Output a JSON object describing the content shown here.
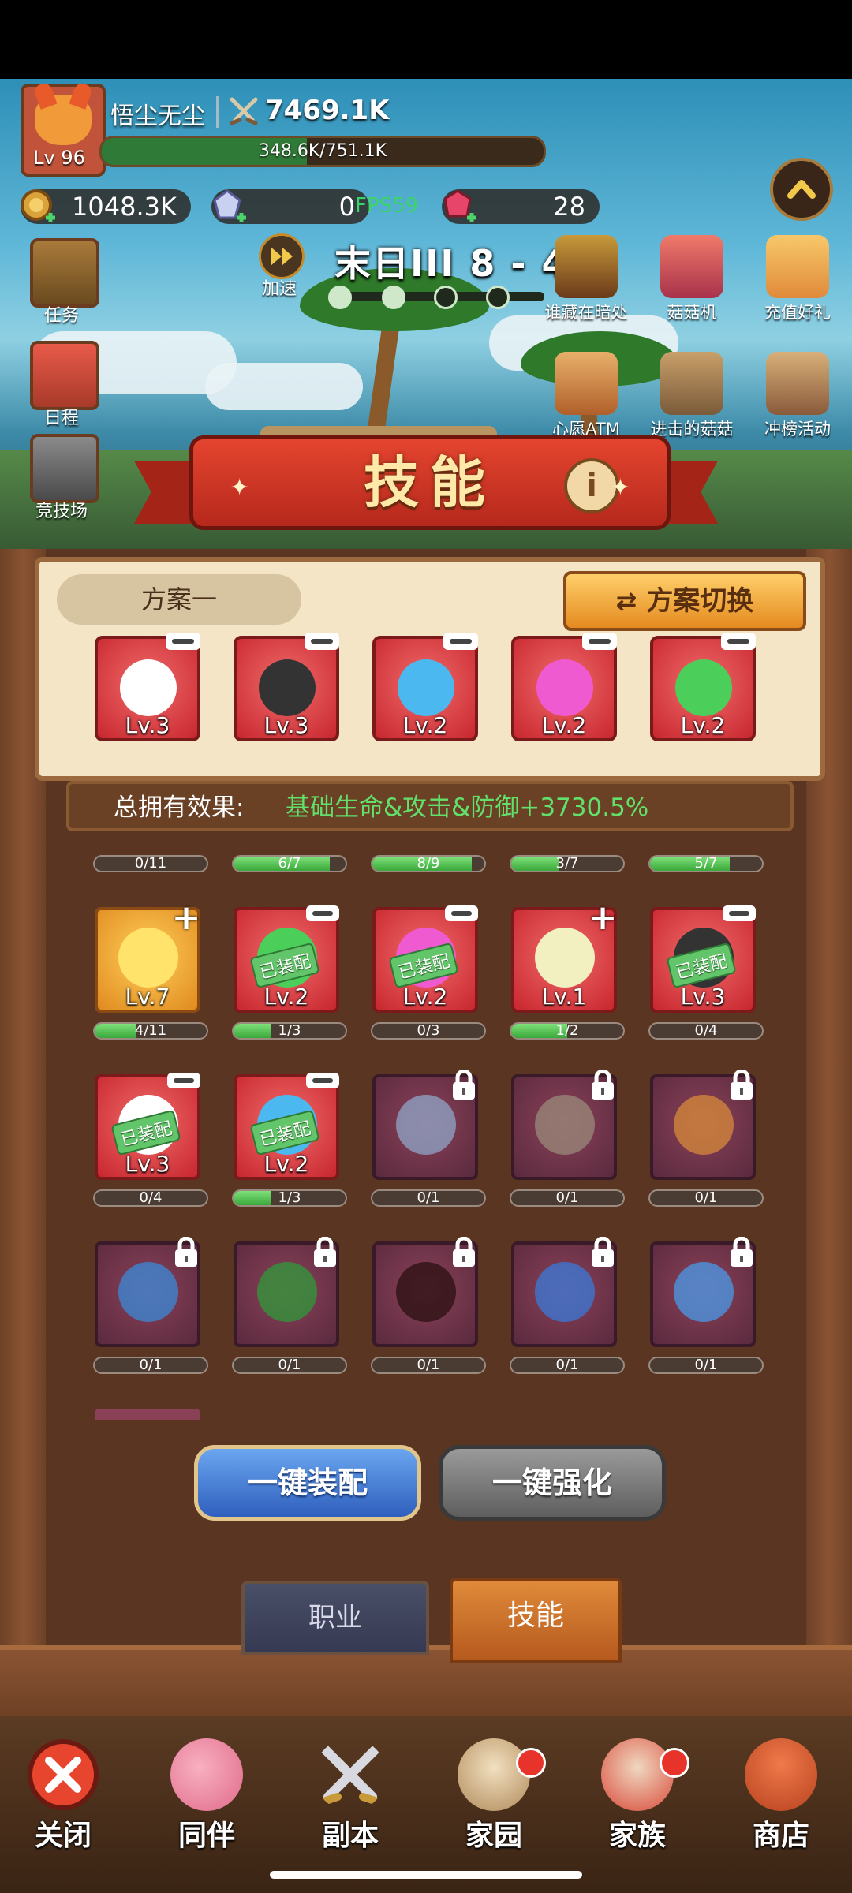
{
  "header": {
    "player_name": "悟尘无尘",
    "power": "7469.1K",
    "level": "Lv 96",
    "exp_text": "348.6K/751.1K",
    "exp_fraction": 0.464
  },
  "resources": {
    "gold": "1048.3K",
    "crystal": "0",
    "fps": "FPS59",
    "gem": "28"
  },
  "stage": {
    "speed_label": "加速",
    "title": "末日III  8 - 4"
  },
  "side_menu": {
    "task": "任务",
    "schedule": "日程",
    "arena": "竞技场"
  },
  "events": {
    "hidden": "谁藏在暗处",
    "machine": "菇菇机",
    "recharge": "充值好礼",
    "atm": "心愿ATM",
    "advance": "进击的菇菇",
    "rank": "冲榜活动"
  },
  "panel": {
    "title": "技能",
    "plan_name": "方案一",
    "plan_switch": "方案切换",
    "effect_label": "总拥有效果:",
    "effect_value": "基础生命&攻击&防御+3730.5%",
    "equipped_badge": "已装配"
  },
  "equipped_slots": [
    {
      "level": "Lv.3",
      "icon": "armored-knight",
      "color": "#ffffff"
    },
    {
      "level": "Lv.3",
      "icon": "dark-rider",
      "color": "#333333"
    },
    {
      "level": "Lv.2",
      "icon": "tornado",
      "color": "#4cb8f0"
    },
    {
      "level": "Lv.2",
      "icon": "pink-spore",
      "color": "#f05ad0"
    },
    {
      "level": "Lv.2",
      "icon": "green-slime",
      "color": "#4ccf5a"
    }
  ],
  "top_progress": [
    {
      "text": "0/11",
      "fraction": 0
    },
    {
      "text": "6/7",
      "fraction": 0.857
    },
    {
      "text": "8/9",
      "fraction": 0.889
    },
    {
      "text": "3/7",
      "fraction": 0.429
    },
    {
      "text": "5/7",
      "fraction": 0.714
    }
  ],
  "skills_row1": [
    {
      "level": "Lv.7",
      "icon": "golden-star",
      "style": "gold",
      "badge": "plus",
      "equipped": false,
      "progress": "4/11",
      "fraction": 0.364,
      "color": "#ffe36a"
    },
    {
      "level": "Lv.2",
      "icon": "green-slime",
      "style": "red",
      "badge": "minus",
      "equipped": true,
      "progress": "1/3",
      "fraction": 0.333,
      "color": "#4ccf5a"
    },
    {
      "level": "Lv.2",
      "icon": "pink-spore",
      "style": "red",
      "badge": "minus",
      "equipped": true,
      "progress": "0/3",
      "fraction": 0,
      "color": "#f05ad0"
    },
    {
      "level": "Lv.1",
      "icon": "flower-bud",
      "style": "red",
      "badge": "plus",
      "equipped": false,
      "progress": "1/2",
      "fraction": 0.5,
      "color": "#f2f0c0"
    },
    {
      "level": "Lv.3",
      "icon": "dark-rider",
      "style": "red",
      "badge": "minus",
      "equipped": true,
      "progress": "0/4",
      "fraction": 0,
      "color": "#333333"
    }
  ],
  "skills_row2": [
    {
      "level": "Lv.3",
      "icon": "armored-knight",
      "style": "red",
      "badge": "minus",
      "equipped": true,
      "progress": "0/4",
      "fraction": 0,
      "color": "#ffffff"
    },
    {
      "level": "Lv.2",
      "icon": "tornado",
      "style": "red",
      "badge": "minus",
      "equipped": true,
      "progress": "1/3",
      "fraction": 0.333,
      "color": "#4cb8f0"
    },
    {
      "level": "",
      "icon": "lightning-bolt",
      "style": "locked",
      "badge": "lock",
      "equipped": false,
      "progress": "0/1",
      "fraction": 0,
      "color": "#8fa6c8"
    },
    {
      "level": "",
      "icon": "sword-strike",
      "style": "locked",
      "badge": "lock",
      "equipped": false,
      "progress": "0/1",
      "fraction": 0,
      "color": "#9a8a7a"
    },
    {
      "level": "",
      "icon": "mushroom-fire",
      "style": "locked",
      "badge": "lock",
      "equipped": false,
      "progress": "0/1",
      "fraction": 0,
      "color": "#d78a3a"
    }
  ],
  "skills_row3": [
    {
      "level": "",
      "icon": "water-whirl",
      "style": "locked",
      "badge": "lock",
      "equipped": false,
      "progress": "0/1",
      "fraction": 0,
      "color": "#3a8ad8"
    },
    {
      "level": "",
      "icon": "green-spear",
      "style": "locked",
      "badge": "lock",
      "equipped": false,
      "progress": "0/1",
      "fraction": 0,
      "color": "#2f9a3a"
    },
    {
      "level": "",
      "icon": "black-vortex",
      "style": "locked",
      "badge": "lock",
      "equipped": false,
      "progress": "0/1",
      "fraction": 0,
      "color": "#2a1010"
    },
    {
      "level": "",
      "icon": "water-dragon",
      "style": "locked",
      "badge": "lock",
      "equipped": false,
      "progress": "0/1",
      "fraction": 0,
      "color": "#3a7ad8"
    },
    {
      "level": "",
      "icon": "star-link",
      "style": "locked",
      "badge": "lock",
      "equipped": false,
      "progress": "0/1",
      "fraction": 0,
      "color": "#4a9ae8"
    }
  ],
  "buttons": {
    "equip_all": "一键装配",
    "upgrade_all": "一键强化"
  },
  "tabs": {
    "job": "职业",
    "skill": "技能"
  },
  "nav": {
    "close": "关闭",
    "partner": "同伴",
    "dungeon": "副本",
    "home": "家园",
    "clan": "家族",
    "shop": "商店"
  }
}
